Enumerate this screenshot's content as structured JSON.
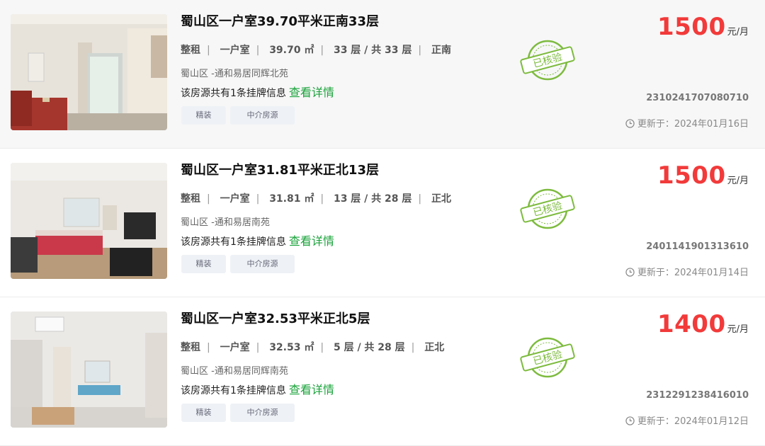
{
  "listings": [
    {
      "title": "蜀山区一户室39.70平米正南33层",
      "attrs": [
        "整租",
        "一户室",
        "39.70 ㎡",
        "33 层 / 共 33 层",
        "正南"
      ],
      "community": "蜀山区 -通和易居同辉北苑",
      "listing_text": "该房源共有1条挂牌信息",
      "detail_link": "查看详情",
      "tags": [
        "精装",
        "中介房源"
      ],
      "stamp": "已核验",
      "price": "1500",
      "price_unit": "元/月",
      "code": "2310241707080710",
      "updated": "更新于：2024年01月16日",
      "photo_icon": "room-photo"
    },
    {
      "title": "蜀山区一户室31.81平米正北13层",
      "attrs": [
        "整租",
        "一户室",
        "31.81 ㎡",
        "13 层 / 共 28 层",
        "正北"
      ],
      "community": "蜀山区 -通和易居南苑",
      "listing_text": "该房源共有1条挂牌信息",
      "detail_link": "查看详情",
      "tags": [
        "精装",
        "中介房源"
      ],
      "stamp": "已核验",
      "price": "1500",
      "price_unit": "元/月",
      "code": "2401141901313610",
      "updated": "更新于：2024年01月14日",
      "photo_icon": "room-photo"
    },
    {
      "title": "蜀山区一户室32.53平米正北5层",
      "attrs": [
        "整租",
        "一户室",
        "32.53 ㎡",
        "5 层 / 共 28 层",
        "正北"
      ],
      "community": "蜀山区 -通和易居同辉南苑",
      "listing_text": "该房源共有1条挂牌信息",
      "detail_link": "查看详情",
      "tags": [
        "精装",
        "中介房源"
      ],
      "stamp": "已核验",
      "price": "1400",
      "price_unit": "元/月",
      "code": "2312291238416010",
      "updated": "更新于：2024年01月12日",
      "photo_icon": "room-photo"
    }
  ],
  "colors": {
    "price": "#f23a3a",
    "link": "#1aa33b",
    "stamp": "#7dbb3e",
    "tag_bg": "#eef2f6"
  }
}
